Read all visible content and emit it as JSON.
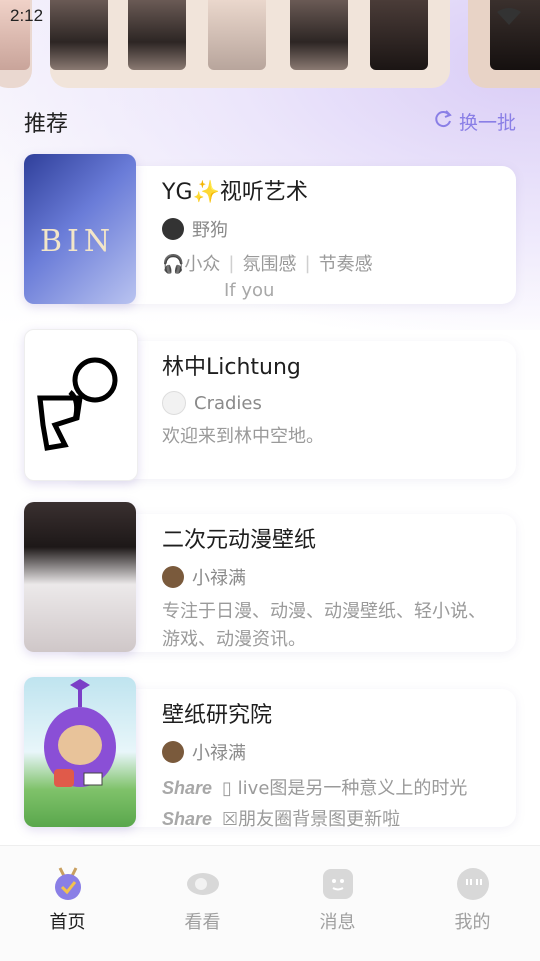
{
  "status_bar": {
    "time": "2:12"
  },
  "section": {
    "title": "推荐",
    "refresh_label": "换一批"
  },
  "cards": [
    {
      "title": "YG✨视听艺术",
      "author": "野狗",
      "tags": [
        "🎧小众",
        "氛围感",
        "节奏感"
      ],
      "subline": "If you",
      "cover_text": "BIN"
    },
    {
      "title": "林中Lichtung",
      "author": "Cradies",
      "desc": "欢迎来到林中空地。"
    },
    {
      "title": "二次元动漫壁纸",
      "author": "小禄满",
      "desc": "专注于日漫、动漫、动漫壁纸、轻小说、游戏、动漫资讯。"
    },
    {
      "title": "壁纸研究院",
      "author": "小禄满",
      "lines": [
        {
          "prefix": "Share",
          "text": "▯ live图是另一种意义上的时光"
        },
        {
          "prefix": "Share",
          "text": "☒朋友圈背景图更新啦"
        }
      ]
    }
  ],
  "tabs": [
    {
      "label": "首页",
      "active": true,
      "icon": "home-medal-icon"
    },
    {
      "label": "看看",
      "active": false,
      "icon": "eye-icon"
    },
    {
      "label": "消息",
      "active": false,
      "icon": "message-face-icon"
    },
    {
      "label": "我的",
      "active": false,
      "icon": "profile-face-icon"
    }
  ],
  "colors": {
    "accent": "#8a7fe6",
    "active_tab": "#1e1e1e",
    "inactive_tab": "#a0a0a0"
  }
}
